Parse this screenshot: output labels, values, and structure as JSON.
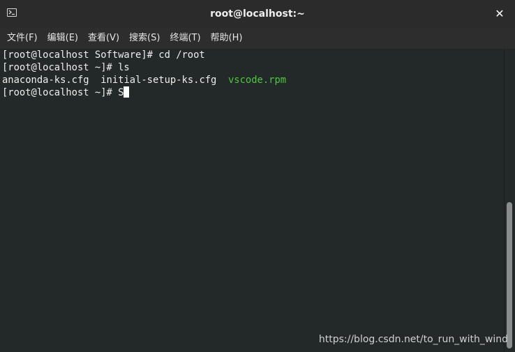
{
  "window": {
    "title": "root@localhost:~",
    "close_glyph": "✕"
  },
  "menu": {
    "items": [
      {
        "label": "文件(F)"
      },
      {
        "label": "编辑(E)"
      },
      {
        "label": "查看(V)"
      },
      {
        "label": "搜索(S)"
      },
      {
        "label": "终端(T)"
      },
      {
        "label": "帮助(H)"
      }
    ]
  },
  "terminal": {
    "lines": [
      "[root@localhost Software]# cd /root",
      "[root@localhost ~]# ls"
    ],
    "ls_output": {
      "file1": "anaconda-ks.cfg",
      "sep1": "  ",
      "file2": "initial-setup-ks.cfg",
      "sep2": "  ",
      "file3": "vscode.rpm"
    },
    "prompt": "[root@localhost ~]# ",
    "current_input": "S"
  },
  "watermark": "https://blog.csdn.net/to_run_with_wind",
  "colors": {
    "background": "#232829",
    "titlebar": "#2b2b2b",
    "text": "#eeeeec",
    "executable_green": "#4cc93c"
  },
  "icons": {
    "window_icon": "terminal-icon",
    "close": "close-icon"
  }
}
